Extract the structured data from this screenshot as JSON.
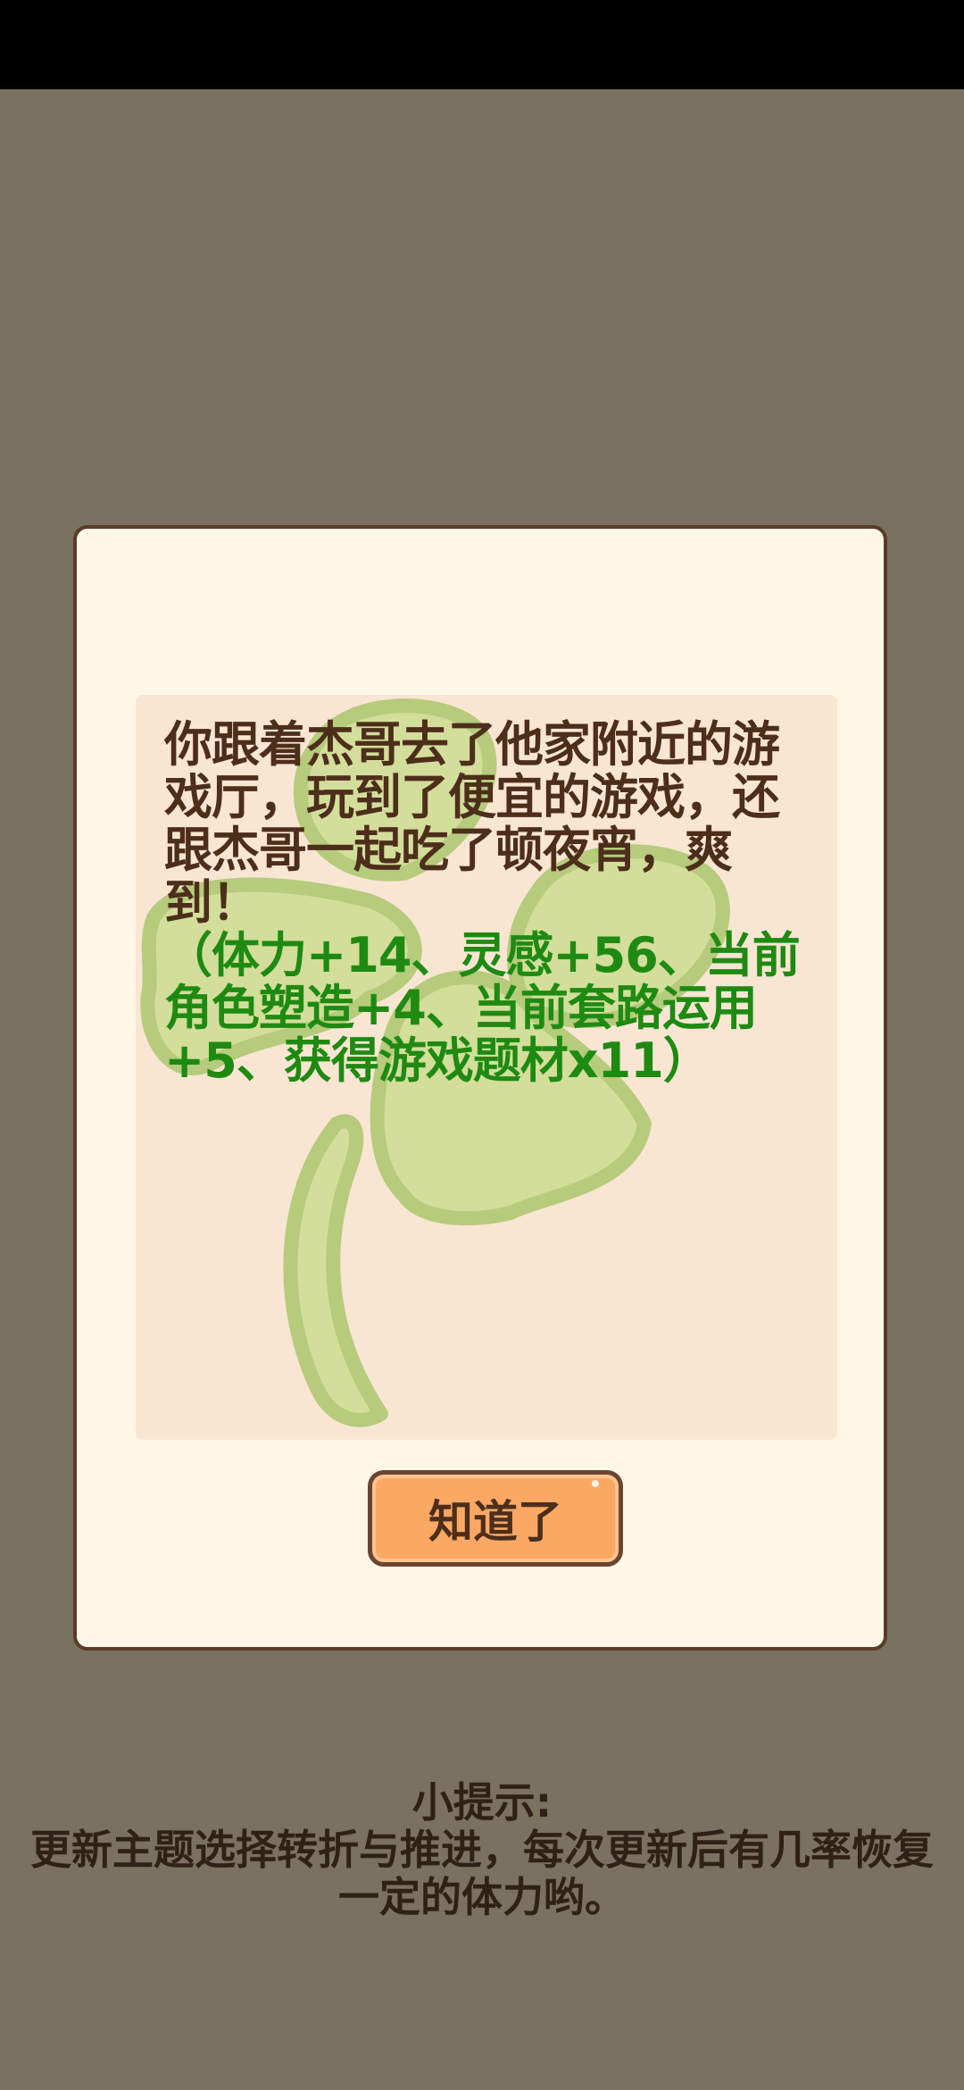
{
  "dialog": {
    "message": "你跟着杰哥去了他家附近的游戏厅，玩到了便宜的游戏，还跟杰哥一起吃了顿夜宵，爽到！",
    "rewards": "（体力+14、灵感+56、当前角色塑造+4、当前套路运用+5、获得游戏题材x11）",
    "ack_button_label": "知道了"
  },
  "tip": {
    "title": "小提示:",
    "line1": "更新主题选择转折与推进，每次更新后有几率恢复",
    "line2": "一定的体力哟。"
  },
  "colors": {
    "background": "#7a7160",
    "dialog_bg": "#fff6e6",
    "panel_bg": "#f8e6d3",
    "message_text": "#4d2e1b",
    "reward_text": "#1f8a12",
    "button_bg": "#fba865"
  },
  "icons": {
    "panel_decoration": "four-leaf-clover"
  }
}
